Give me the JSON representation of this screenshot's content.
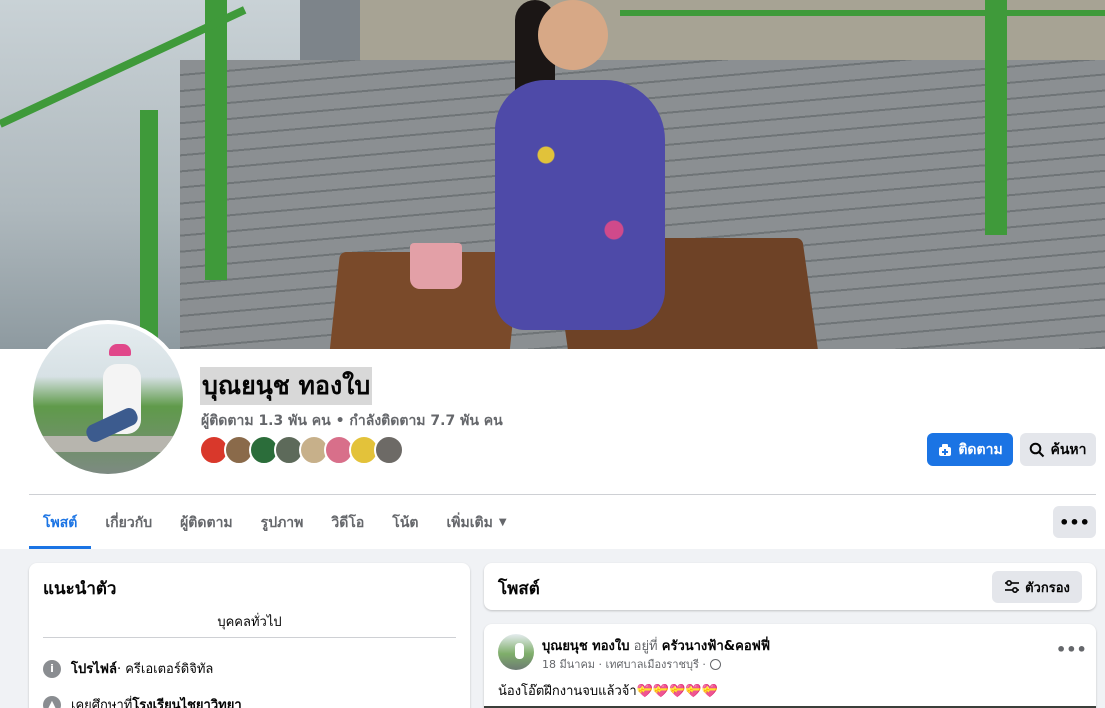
{
  "profile": {
    "name": "บุณยนุช ทองใบ",
    "stats": "ผู้ติดตาม 1.3 พัน คน • กำลังติดตาม 7.7 พัน คน",
    "friend_avatar_colors": [
      "#d9382b",
      "#8a6a4a",
      "#2b6d3a",
      "#5d6a5a",
      "#c7b08a",
      "#d86f8a",
      "#e3c23a",
      "#6d6a66"
    ]
  },
  "actions": {
    "follow_label": "ติดตาม",
    "search_label": "ค้นหา",
    "more_label": "•••"
  },
  "tabs": [
    {
      "label": "โพสต์",
      "active": true
    },
    {
      "label": "เกี่ยวกับ",
      "active": false
    },
    {
      "label": "ผู้ติดตาม",
      "active": false
    },
    {
      "label": "รูปภาพ",
      "active": false
    },
    {
      "label": "วิดีโอ",
      "active": false
    },
    {
      "label": "โน้ต",
      "active": false
    },
    {
      "label": "เพิ่มเติม",
      "active": false
    }
  ],
  "intro": {
    "title": "แนะนำตัว",
    "audience": "บุคคลทั่วไป",
    "profile_label": "โปรไฟล์",
    "profile_value": " · ครีเอเตอร์ดิจิทัล",
    "education_prefix": "เคยศึกษาที่ ",
    "education_value": "โรงเรียนไชยาวิทยา"
  },
  "posts": {
    "title": "โพสต์",
    "filter_label": "ตัวกรอง"
  },
  "post": {
    "author": "บุณยนุช ทองใบ",
    "at_label": " อยู่ที่ ",
    "place": "ครัวนางฟ้า&คอฟฟี่",
    "meta": "18 มีนาคม · เทศบาลเมืองราชบุรี ·",
    "text": "น้องโอ๊ตฝึกงานจบแล้วจ้า💝💝💝💝💝",
    "dots": "•••"
  },
  "colors": {
    "accent": "#1b74e4",
    "button_gray": "#e4e6eb",
    "page_bg": "#f0f2f5",
    "muted_text": "#65676b"
  }
}
